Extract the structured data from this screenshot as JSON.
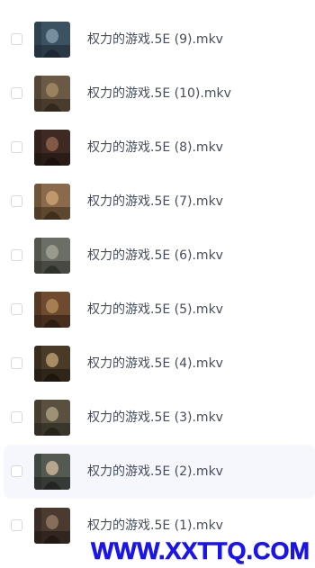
{
  "files": [
    {
      "name": "权力的游戏.5E (9).mkv",
      "thumb": {
        "bg": "#3b5262",
        "fg": "#1b2530",
        "accent": "#8ba3b4"
      }
    },
    {
      "name": "权力的游戏.5E (10).mkv",
      "thumb": {
        "bg": "#6a5a45",
        "fg": "#2e241a",
        "accent": "#a8906a"
      }
    },
    {
      "name": "权力的游戏.5E (8).mkv",
      "thumb": {
        "bg": "#3e2a22",
        "fg": "#1a100c",
        "accent": "#9a6a52"
      }
    },
    {
      "name": "权力的游戏.5E (7).mkv",
      "thumb": {
        "bg": "#8a6a4a",
        "fg": "#3a2a1a",
        "accent": "#d0a878"
      }
    },
    {
      "name": "权力的游戏.5E (6).mkv",
      "thumb": {
        "bg": "#6b6e64",
        "fg": "#2a2c26",
        "accent": "#a8a89a"
      }
    },
    {
      "name": "权力的游戏.5E (5).mkv",
      "thumb": {
        "bg": "#6e4a2e",
        "fg": "#2a1a10",
        "accent": "#b8905e"
      }
    },
    {
      "name": "权力的游戏.5E (4).mkv",
      "thumb": {
        "bg": "#4a3a28",
        "fg": "#1a140c",
        "accent": "#c8a878"
      }
    },
    {
      "name": "权力的游戏.5E (3).mkv",
      "thumb": {
        "bg": "#5a5040",
        "fg": "#222018",
        "accent": "#b4a888"
      }
    },
    {
      "name": "权力的游戏.5E (2).mkv",
      "thumb": {
        "bg": "#545a52",
        "fg": "#1e2220",
        "accent": "#d8c0a0"
      }
    },
    {
      "name": "权力的游戏.5E (1).mkv",
      "thumb": {
        "bg": "#4a3a30",
        "fg": "#1e1612",
        "accent": "#9a8068"
      }
    }
  ],
  "hovered_index": 8,
  "watermark": "WWW.XXTTQ.COM",
  "colors": {
    "text": "#454d5a",
    "row_hover_bg": "#f5f7fc",
    "checkbox_border": "#d6d9e0",
    "watermark": "#1a14e8"
  }
}
